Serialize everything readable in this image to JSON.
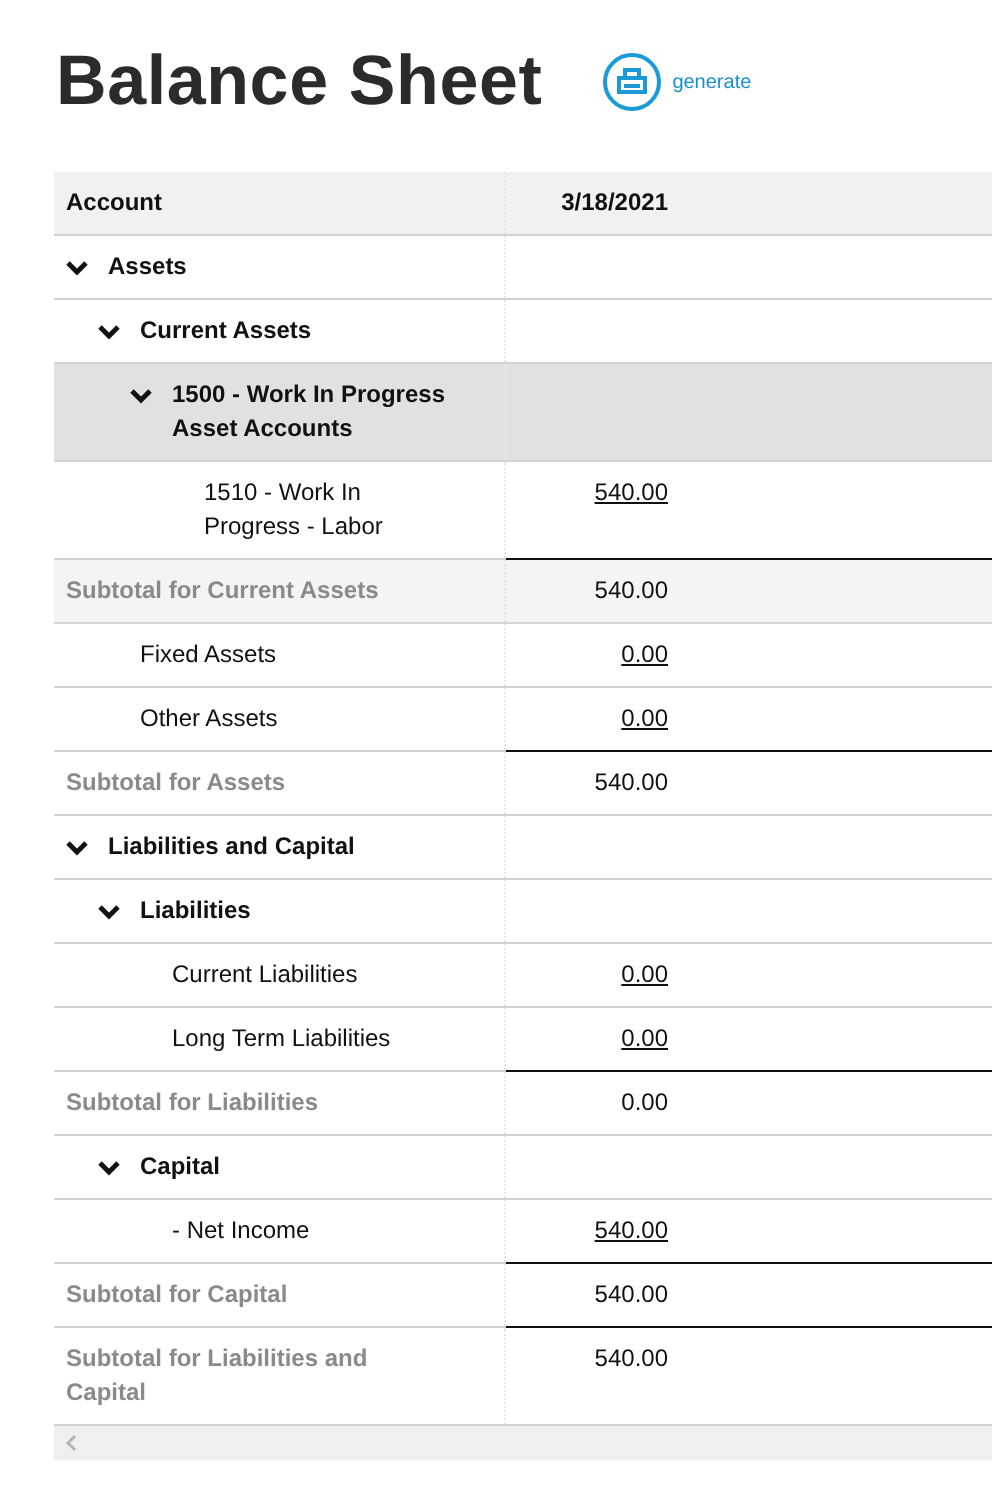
{
  "title": "Balance Sheet",
  "generate": {
    "label": "generate"
  },
  "table": {
    "columns": [
      "Account",
      "3/18/2021"
    ],
    "rows": [
      {
        "kind": "group",
        "label": "Assets",
        "expanded": true,
        "children": [
          {
            "kind": "group",
            "label": "Current Assets",
            "expanded": true,
            "children": [
              {
                "kind": "group",
                "label": "1500 - Work In Progress Asset Accounts",
                "expanded": true,
                "highlighted": true,
                "children": [
                  {
                    "kind": "account",
                    "label": "1510 - Work In Progress - Labor",
                    "amount": "540.00"
                  }
                ]
              },
              {
                "kind": "subtotal",
                "label": "Subtotal for Current Assets",
                "amount": "540.00",
                "hovered": true
              }
            ]
          },
          {
            "kind": "account",
            "label": "Fixed Assets",
            "amount": "0.00"
          },
          {
            "kind": "account",
            "label": "Other Assets",
            "amount": "0.00"
          },
          {
            "kind": "subtotal",
            "label": "Subtotal for Assets",
            "amount": "540.00"
          }
        ]
      },
      {
        "kind": "group",
        "label": "Liabilities and Capital",
        "expanded": true,
        "children": [
          {
            "kind": "group",
            "label": "Liabilities",
            "expanded": true,
            "children": [
              {
                "kind": "account",
                "label": "Current Liabilities",
                "amount": "0.00"
              },
              {
                "kind": "account",
                "label": "Long Term Liabilities",
                "amount": "0.00"
              },
              {
                "kind": "subtotal",
                "label": "Subtotal for Liabilities",
                "amount": "0.00"
              }
            ]
          },
          {
            "kind": "group",
            "label": "Capital",
            "expanded": true,
            "children": [
              {
                "kind": "account",
                "label": "- Net Income",
                "amount": "540.00"
              },
              {
                "kind": "subtotal",
                "label": "Subtotal for Capital",
                "amount": "540.00"
              }
            ]
          },
          {
            "kind": "subtotal",
            "label": "Subtotal for Liabilities and Capital",
            "amount": "540.00"
          }
        ]
      }
    ]
  }
}
